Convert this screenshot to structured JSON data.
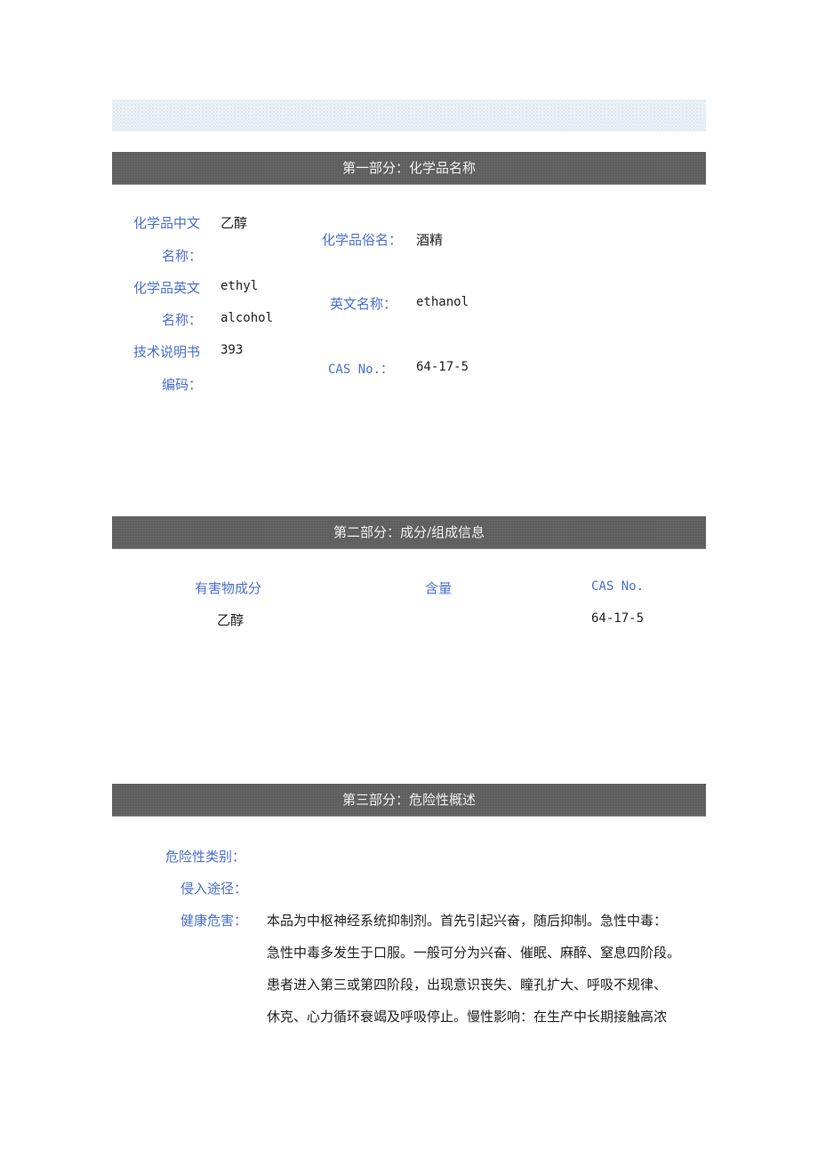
{
  "section1": {
    "title": "第一部分：化学品名称",
    "fields": {
      "cn_name_label_1": "化学品中文",
      "cn_name_label_2": "名称：",
      "cn_name_value": "乙醇",
      "common_name_label": "化学品俗名：",
      "common_name_value": "酒精",
      "en_name_label_1": "化学品英文",
      "en_name_label_2": "名称：",
      "en_name_value_1": "ethyl",
      "en_name_value_2": "alcohol",
      "en_alias_label": "英文名称：",
      "en_alias_value": "ethanol",
      "spec_code_label_1": "技术说明书",
      "spec_code_label_2": "编码：",
      "spec_code_value": "393",
      "cas_label": "CAS No.：",
      "cas_value": "64-17-5"
    }
  },
  "section2": {
    "title": "第二部分：成分/组成信息",
    "columns": [
      "有害物成分",
      "含量",
      "CAS No."
    ],
    "rows": [
      {
        "component": "乙醇",
        "content": "",
        "cas": "64-17-5"
      }
    ]
  },
  "section3": {
    "title": "第三部分：危险性概述",
    "hazard_class_label": "危险性类别：",
    "hazard_class_value": "",
    "route_label": "侵入途径：",
    "route_value": "",
    "health_label": "健康危害：",
    "health_lines": [
      "本品为中枢神经系统抑制剂。首先引起兴奋，随后抑制。急性中毒：",
      "急性中毒多发生于口服。一般可分为兴奋、催眠、麻醉、窒息四阶段。",
      "患者进入第三或第四阶段，出现意识丧失、瞳孔扩大、呼吸不规律、",
      "休克、心力循环衰竭及呼吸停止。慢性影响：在生产中长期接触高浓"
    ]
  }
}
